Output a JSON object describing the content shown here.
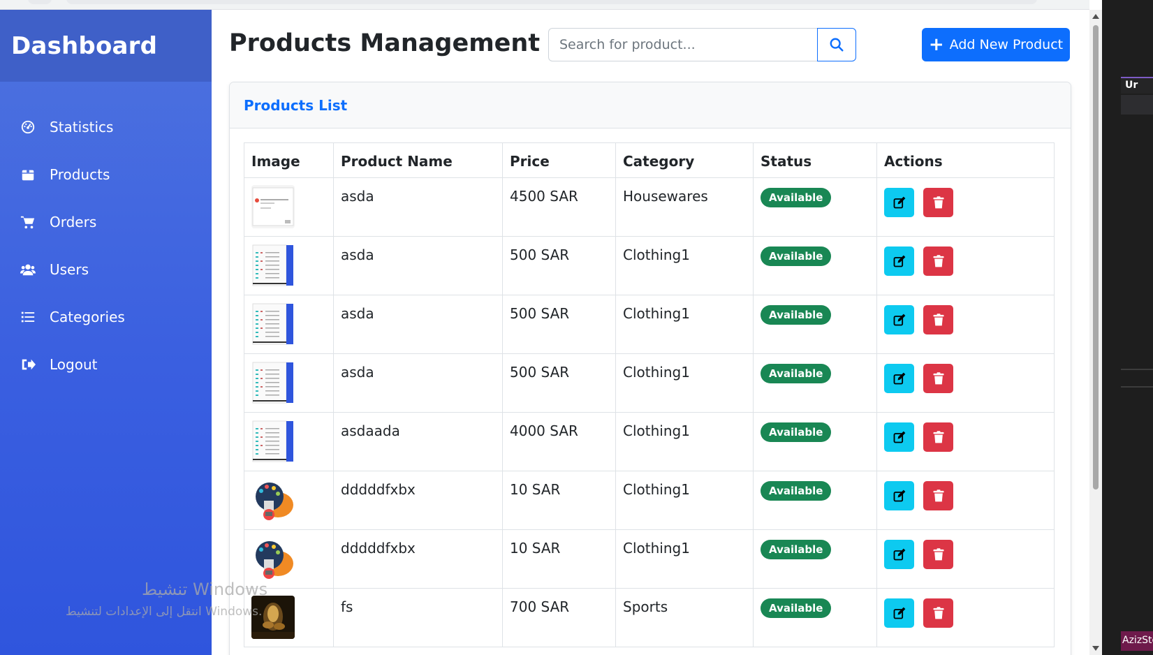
{
  "sidebar": {
    "brand": "Dashboard",
    "items": [
      {
        "label": "Statistics",
        "icon": "gauge-icon"
      },
      {
        "label": "Products",
        "icon": "box-icon"
      },
      {
        "label": "Orders",
        "icon": "cart-icon"
      },
      {
        "label": "Users",
        "icon": "users-icon"
      },
      {
        "label": "Categories",
        "icon": "list-icon"
      },
      {
        "label": "Logout",
        "icon": "logout-icon"
      }
    ]
  },
  "header": {
    "title": "Products Management",
    "search_placeholder": "Search for product...",
    "add_button_label": "Add New Product"
  },
  "card": {
    "title": "Products List",
    "columns": [
      "Image",
      "Product Name",
      "Price",
      "Category",
      "Status",
      "Actions"
    ],
    "rows": [
      {
        "thumb": "screenshot-light",
        "name": "asda",
        "price": "4500 SAR",
        "category": "Housewares",
        "status": "Available"
      },
      {
        "thumb": "screenshot-blue",
        "name": "asda",
        "price": "500 SAR",
        "category": "Clothing1",
        "status": "Available"
      },
      {
        "thumb": "screenshot-blue",
        "name": "asda",
        "price": "500 SAR",
        "category": "Clothing1",
        "status": "Available"
      },
      {
        "thumb": "screenshot-blue",
        "name": "asda",
        "price": "500 SAR",
        "category": "Clothing1",
        "status": "Available"
      },
      {
        "thumb": "screenshot-blue",
        "name": "asdaada",
        "price": "4000 SAR",
        "category": "Clothing1",
        "status": "Available"
      },
      {
        "thumb": "illustration-orange",
        "name": "dddddfxbx",
        "price": "10 SAR",
        "category": "Clothing1",
        "status": "Available"
      },
      {
        "thumb": "illustration-orange",
        "name": "dddddfxbx",
        "price": "10 SAR",
        "category": "Clothing1",
        "status": "Available"
      },
      {
        "thumb": "photo-dark",
        "name": "fs",
        "price": "700 SAR",
        "category": "Sports",
        "status": "Available"
      }
    ]
  },
  "colors": {
    "sidebar": "#4e73df",
    "primary": "#0d6efd",
    "success": "#198754",
    "info": "#0dcaf0",
    "danger": "#dc3545"
  },
  "side_panel": {
    "tab_label": "Ur",
    "task_label": "AzizSto"
  },
  "watermark": {
    "line1": "تنشيط Windows",
    "line2": "انتقل إلى الإعدادات لتنشيط Windows."
  }
}
